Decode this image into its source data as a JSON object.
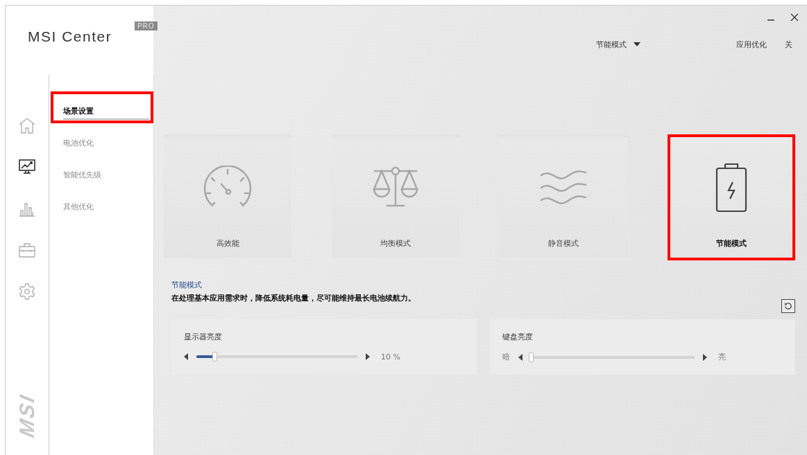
{
  "window": {
    "logo": "MSI Center",
    "badge": "PRO"
  },
  "rail": [
    {
      "kind": "home",
      "selected": false
    },
    {
      "kind": "monitor-chart",
      "selected": true
    },
    {
      "kind": "bars",
      "selected": false
    },
    {
      "kind": "toolbox",
      "selected": false
    },
    {
      "kind": "gear",
      "selected": false
    }
  ],
  "brand_mark": "MSI",
  "submenu": [
    {
      "label": "场景设置",
      "selected": true,
      "highlighted": true
    },
    {
      "label": "电池优化",
      "selected": false,
      "highlighted": false
    },
    {
      "label": "智能优先级",
      "selected": false,
      "highlighted": false
    },
    {
      "label": "其他优化",
      "selected": false,
      "highlighted": false
    }
  ],
  "top_bar": {
    "mode_dropdown": "节能模式",
    "app_optimize_label": "应用优化",
    "app_optimize_value": "关"
  },
  "modes": [
    {
      "kind": "speedometer",
      "label": "高效能",
      "selected": false,
      "highlighted": false
    },
    {
      "kind": "scale",
      "label": "均衡模式",
      "selected": false,
      "highlighted": false
    },
    {
      "kind": "waves",
      "label": "静音模式",
      "selected": false,
      "highlighted": false
    },
    {
      "kind": "battery",
      "label": "节能模式",
      "selected": true,
      "highlighted": true
    }
  ],
  "description": {
    "title": "节能模式",
    "text": "在处理基本应用需求时，降低系统耗电量，尽可能维持最长电池续航力。"
  },
  "sliders": [
    {
      "label": "显示器亮度",
      "level": 0.11,
      "reading": "10 %"
    },
    {
      "label": "键盘亮度",
      "level": 0,
      "min_label": "暗",
      "max_label": "亮"
    }
  ]
}
